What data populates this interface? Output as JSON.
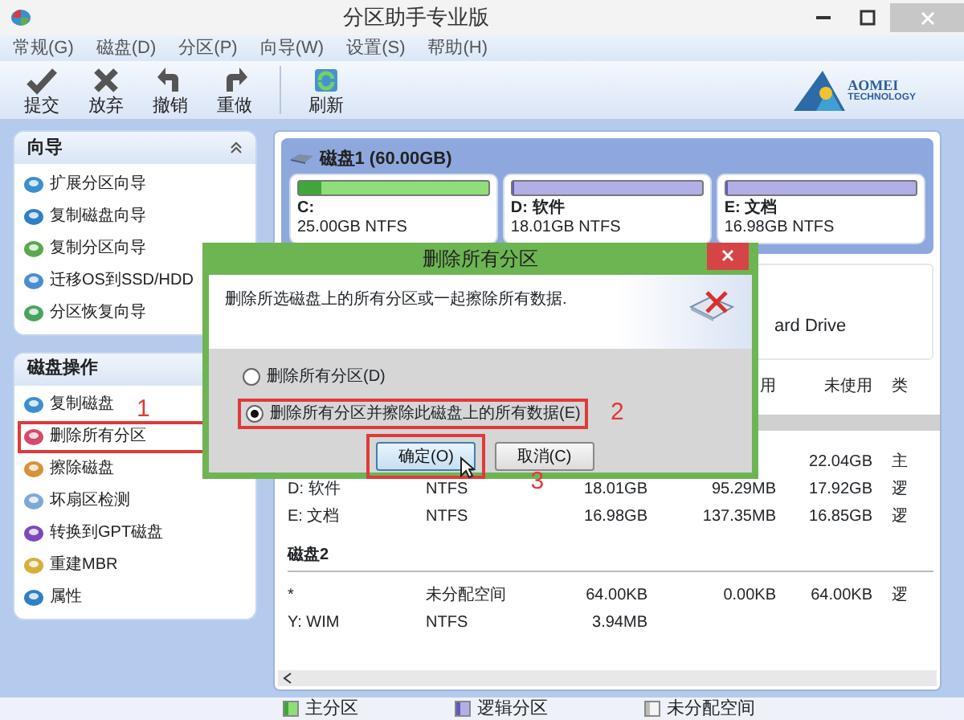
{
  "window": {
    "title": "分区助手专业版"
  },
  "menu": [
    "常规(G)",
    "磁盘(D)",
    "分区(P)",
    "向导(W)",
    "设置(S)",
    "帮助(H)"
  ],
  "toolbar": [
    {
      "label": "提交",
      "kind": "check"
    },
    {
      "label": "放弃",
      "kind": "cross"
    },
    {
      "label": "撤销",
      "kind": "undo"
    },
    {
      "label": "重做",
      "kind": "redo"
    },
    {
      "label": "刷新",
      "kind": "refresh"
    }
  ],
  "logo": {
    "name": "AOMEI",
    "tagline": "TECHNOLOGY"
  },
  "sidebar": [
    {
      "title": "向导",
      "toggle": true,
      "items": [
        {
          "label": "扩展分区向导"
        },
        {
          "label": "复制磁盘向导"
        },
        {
          "label": "复制分区向导"
        },
        {
          "label": "迁移OS到SSD/HDD"
        },
        {
          "label": "分区恢复向导"
        }
      ]
    },
    {
      "title": "磁盘操作",
      "toggle": false,
      "items": [
        {
          "label": "复制磁盘"
        },
        {
          "label": "删除所有分区",
          "callout": "1"
        },
        {
          "label": "擦除磁盘"
        },
        {
          "label": "坏扇区检测"
        },
        {
          "label": "转换到GPT磁盘"
        },
        {
          "label": "重建MBR"
        },
        {
          "label": "属性"
        }
      ]
    }
  ],
  "disk": {
    "title": "磁盘1 (60.00GB)",
    "partitions": [
      {
        "name": "C:",
        "info": "25.00GB NTFS",
        "kind": "primary",
        "level": 0.12
      },
      {
        "name": "D: 软件",
        "info": "18.01GB NTFS",
        "kind": "logical",
        "level": 0.01
      },
      {
        "name": "E: 文档",
        "info": "16.98GB NTFS",
        "kind": "logical",
        "level": 0.01
      }
    ]
  },
  "disk_info": "ard Drive",
  "table": {
    "header": {
      "used": "用",
      "free": "未使用",
      "type": "类"
    },
    "groups": [
      {
        "rows": [
          {
            "free": "22.04GB",
            "type": "主"
          },
          {
            "partition": "D: 软件",
            "fs": "NTFS",
            "capacity": "18.01GB",
            "used": "95.29MB",
            "free": "17.92GB",
            "type": "逻"
          },
          {
            "partition": "E: 文档",
            "fs": "NTFS",
            "capacity": "16.98GB",
            "used": "137.35MB",
            "free": "16.85GB",
            "type": "逻"
          }
        ]
      },
      {
        "title": "磁盘2",
        "rows": [
          {
            "partition": "*",
            "fs": "未分配空间",
            "capacity": "64.00KB",
            "used": "0.00KB",
            "free": "64.00KB",
            "type": "逻"
          },
          {
            "partition": "Y: WIM",
            "fs": "NTFS",
            "capacity": "3.94MB"
          }
        ]
      }
    ]
  },
  "legend": [
    {
      "label": "主分区",
      "kind": "primary"
    },
    {
      "label": "逻辑分区",
      "kind": "logical"
    },
    {
      "label": "未分配空间",
      "kind": "unallocated"
    }
  ],
  "dialog": {
    "title": "删除所有分区",
    "message": "删除所选磁盘上的所有分区或一起擦除所有数据.",
    "options": [
      {
        "label": "删除所有分区(D)",
        "selected": false
      },
      {
        "label": "删除所有分区并擦除此磁盘上的所有数据(E)",
        "selected": true,
        "callout": "2"
      }
    ],
    "buttons": [
      {
        "label": "确定(O)",
        "default": true,
        "callout": "3"
      },
      {
        "label": "取消(C)",
        "default": false
      }
    ]
  }
}
